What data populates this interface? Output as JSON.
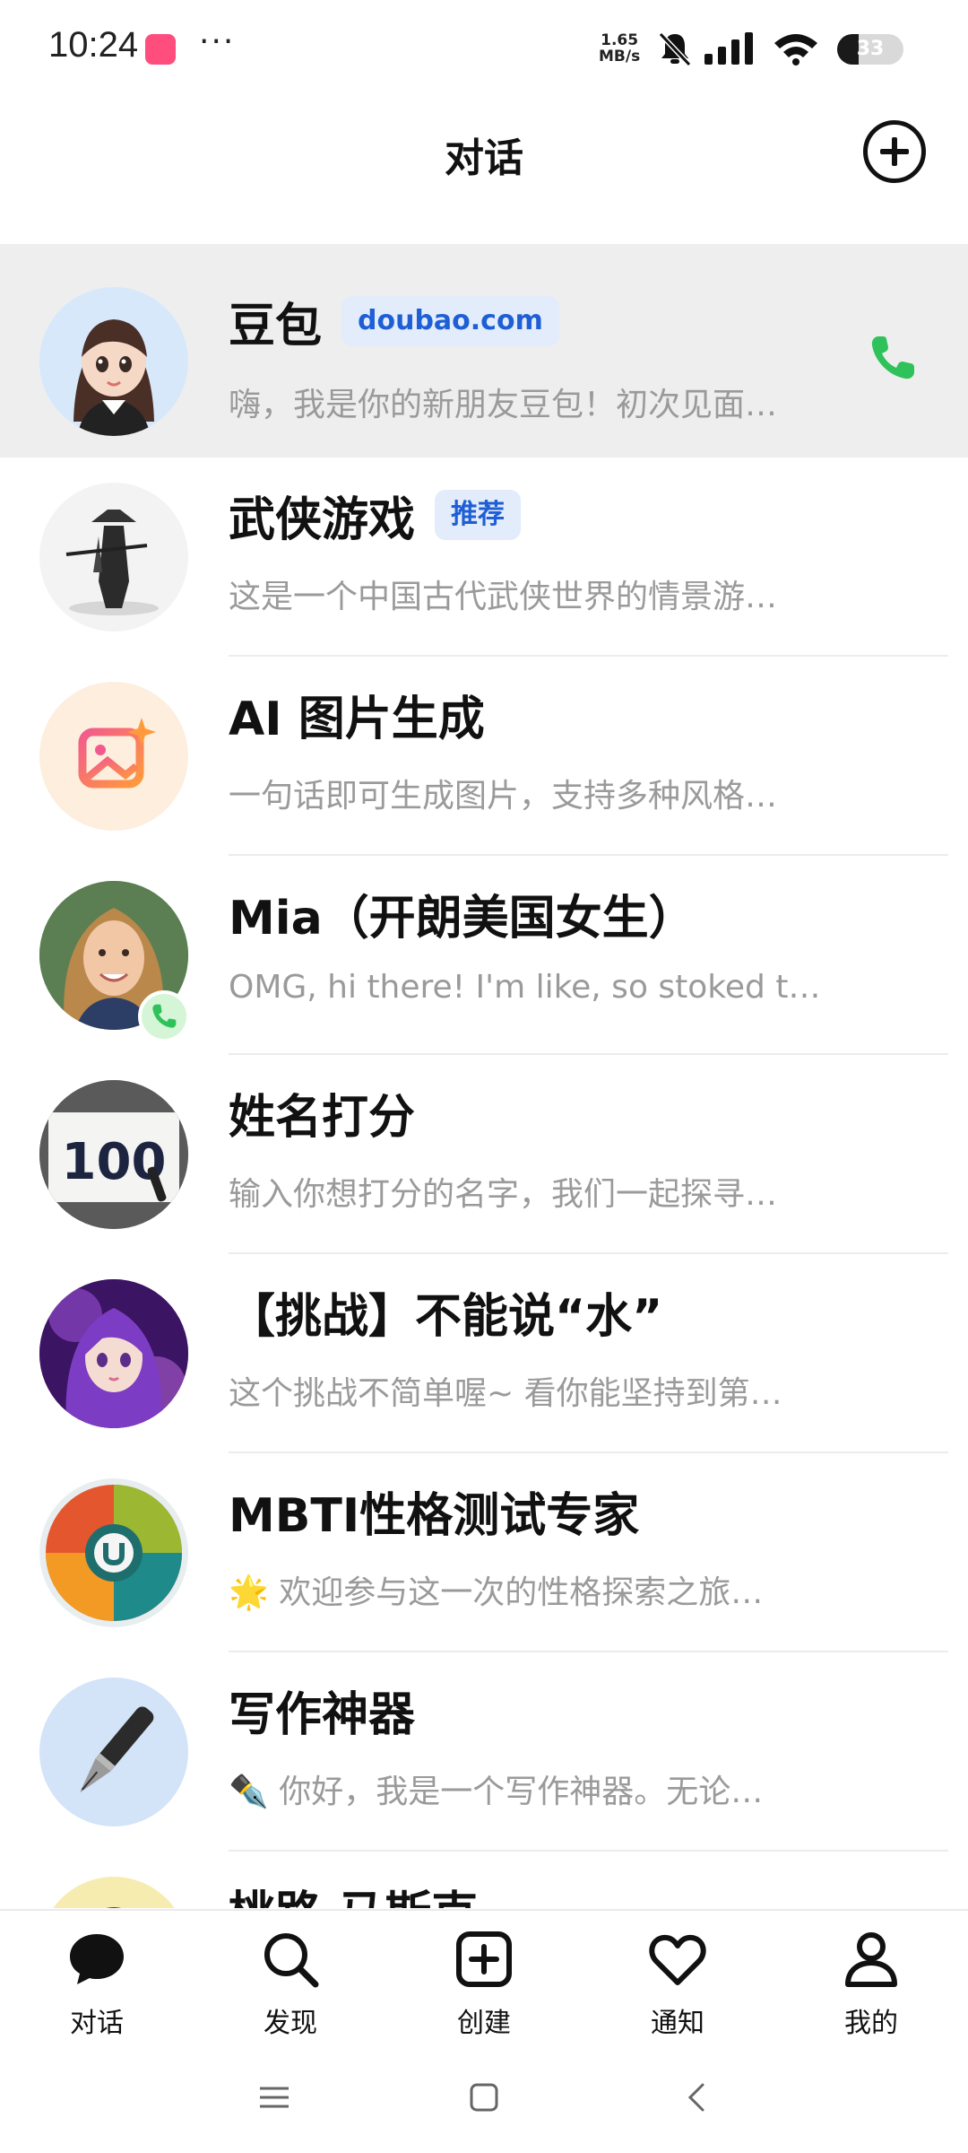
{
  "status_bar": {
    "time": "10:24",
    "more": "···",
    "speed_value": "1.65",
    "speed_unit": "MB/s",
    "battery": "33",
    "battery_level": 0.33,
    "icons": [
      "mute-bell-icon",
      "signal-icon",
      "wifi-icon",
      "battery-icon"
    ]
  },
  "header": {
    "title": "对话",
    "add_icon": "plus-circle-icon"
  },
  "conversations": [
    {
      "name": "豆包",
      "badge": "doubao.com",
      "preview": "嗨，我是你的新朋友豆包！初次见面…",
      "avatar": "girl-avatar",
      "has_call": true
    },
    {
      "name": "武侠游戏",
      "badge": "推荐",
      "preview": "这是一个中国古代武侠世界的情景游…",
      "avatar": "swordsman-avatar"
    },
    {
      "name": "AI 图片生成",
      "preview": "一句话即可生成图片，支持多种风格…",
      "avatar": "image-sparkle-avatar"
    },
    {
      "name": "Mia（开朗美国女生）",
      "preview": "OMG, hi there! I'm like, so stoked to…",
      "avatar": "mia-avatar",
      "has_call_badge": true
    },
    {
      "name": "姓名打分",
      "preview": "输入你想打分的名字，我们一起探寻…",
      "avatar": "score-100-avatar",
      "avatar_text": "100"
    },
    {
      "name": "【挑战】不能说“水”",
      "preview": "这个挑战不简单喔~ 看你能坚持到第…",
      "avatar": "purple-girl-avatar"
    },
    {
      "name": "MBTI性格测试专家",
      "preview": "🌟 欢迎参与这一次的性格探索之旅…",
      "avatar": "mbti-wheel-avatar"
    },
    {
      "name": "写作神器",
      "preview": "✒️ 你好，我是一个写作神器。无论…",
      "avatar": "pen-avatar"
    },
    {
      "name": "桃路 马斯克",
      "preview": "",
      "avatar": "person-avatar"
    }
  ],
  "bottom_nav": [
    {
      "label": "对话",
      "icon": "chat-bubble-icon"
    },
    {
      "label": "发现",
      "icon": "search-icon"
    },
    {
      "label": "创建",
      "icon": "plus-square-icon"
    },
    {
      "label": "通知",
      "icon": "heart-icon"
    },
    {
      "label": "我的",
      "icon": "person-icon"
    }
  ],
  "system_nav": [
    "menu-icon",
    "home-icon",
    "back-icon"
  ],
  "colors": {
    "call_green": "#2fc25b",
    "badge_bg": "#e3ecfb",
    "badge_text": "#1e5fd6",
    "highlight_row": "#eeeeee"
  }
}
